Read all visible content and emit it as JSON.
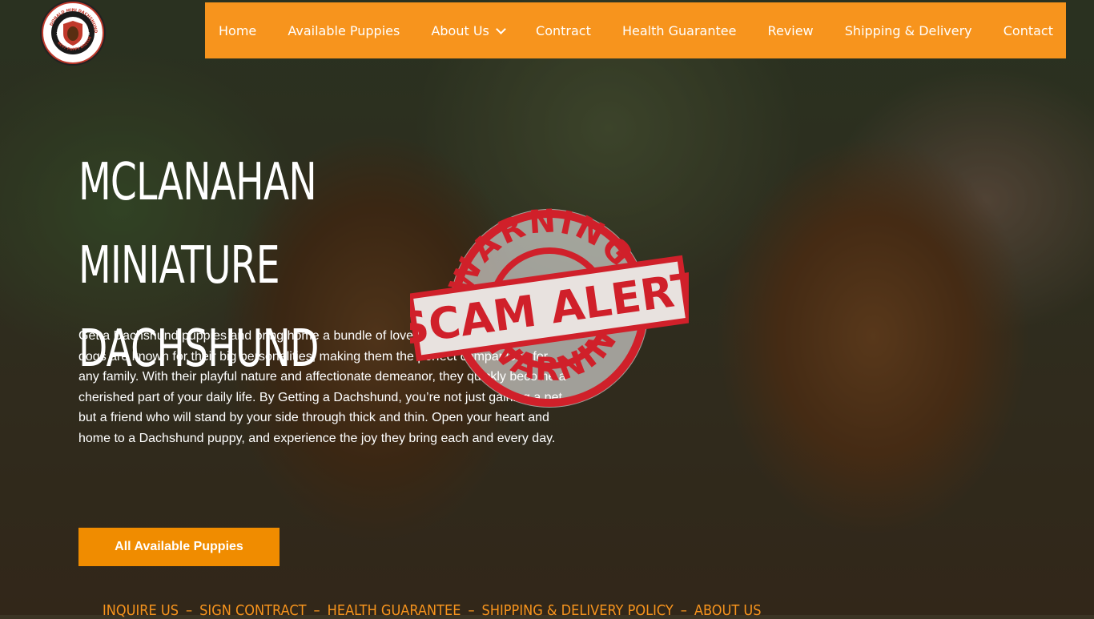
{
  "site": {
    "logo": {
      "ring_text": "DONALD MINI DACHSHUND",
      "bottom_text": "BEST PUPPY BREEDER",
      "year_left": "20",
      "year_right": "10"
    }
  },
  "nav": {
    "items": [
      {
        "label": "Home"
      },
      {
        "label": "Available Puppies"
      },
      {
        "label": "About Us"
      },
      {
        "label": "Contract"
      },
      {
        "label": "Health Guarantee"
      },
      {
        "label": "Review"
      },
      {
        "label": "Shipping & Delivery"
      },
      {
        "label": "Contact"
      }
    ]
  },
  "hero": {
    "title_line1": "MCLANAHAN MINIATURE",
    "title_line2": "DACHSHUND",
    "intro": "Get a Dachshund puppies and bring home a bundle of love and loyalty. These little dogs are known for their big personalities, making them the perfect companions for any family. With their playful nature and affectionate demeanor, they quickly become a cherished part of your daily life. By Getting a Dachshund, you’re not just gaining a pet, but a friend who will stand by your side through thick and thin. Open your heart and home to a Dachshund puppy, and experience the joy they bring each and every day.",
    "cta_label": "All Available Puppies"
  },
  "sub_links": [
    {
      "label": "INQUIRE US"
    },
    {
      "label": "SIGN CONTRACT"
    },
    {
      "label": "HEALTH GUARANTEE"
    },
    {
      "label": "SHIPPING & DELIVERY POLICY"
    },
    {
      "label": "ABOUT US"
    }
  ],
  "stamp": {
    "top_text": "WARNING",
    "banner_text": "SCAM ALERT",
    "bottom_text": "WARNING"
  },
  "colors": {
    "nav_bg": "#f7941d",
    "cta_bg": "#f08c00",
    "stamp_red": "#d0202a"
  }
}
